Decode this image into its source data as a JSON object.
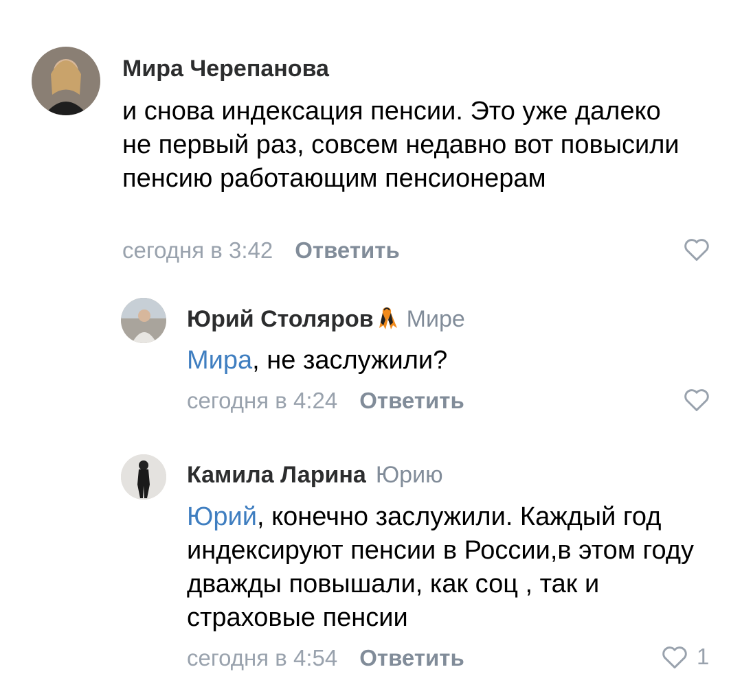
{
  "comments": [
    {
      "author": "Мира Черепанова",
      "reply_to": "",
      "mention": "",
      "text": "и снова индексация пенсии. Это уже далеко не первый раз, совсем недавно вот повысили пенсию работающим пенсионерам",
      "time": "сегодня в 3:42",
      "reply_label": "Ответить",
      "likes": ""
    },
    {
      "author": "Юрий Столяров",
      "reply_to": "Мире",
      "mention": "Мира",
      "text": ", не заслужили?",
      "time": "сегодня в 4:24",
      "reply_label": "Ответить",
      "likes": ""
    },
    {
      "author": "Камила Ларина",
      "reply_to": "Юрию",
      "mention": "Юрий",
      "text": ", конечно заслужили. Каждый год индексируют пенсии в России,в этом году дважды повышали, как соц , так и страховые пенсии",
      "time": "сегодня в 4:54",
      "reply_label": "Ответить",
      "likes": "1"
    }
  ],
  "icons": {
    "author_badge": "st-george-ribbon-icon",
    "like": "heart-outline-icon"
  },
  "colors": {
    "mention": "#3f7ec0",
    "secondary": "#818c99",
    "timestamp": "#99a2ad"
  }
}
